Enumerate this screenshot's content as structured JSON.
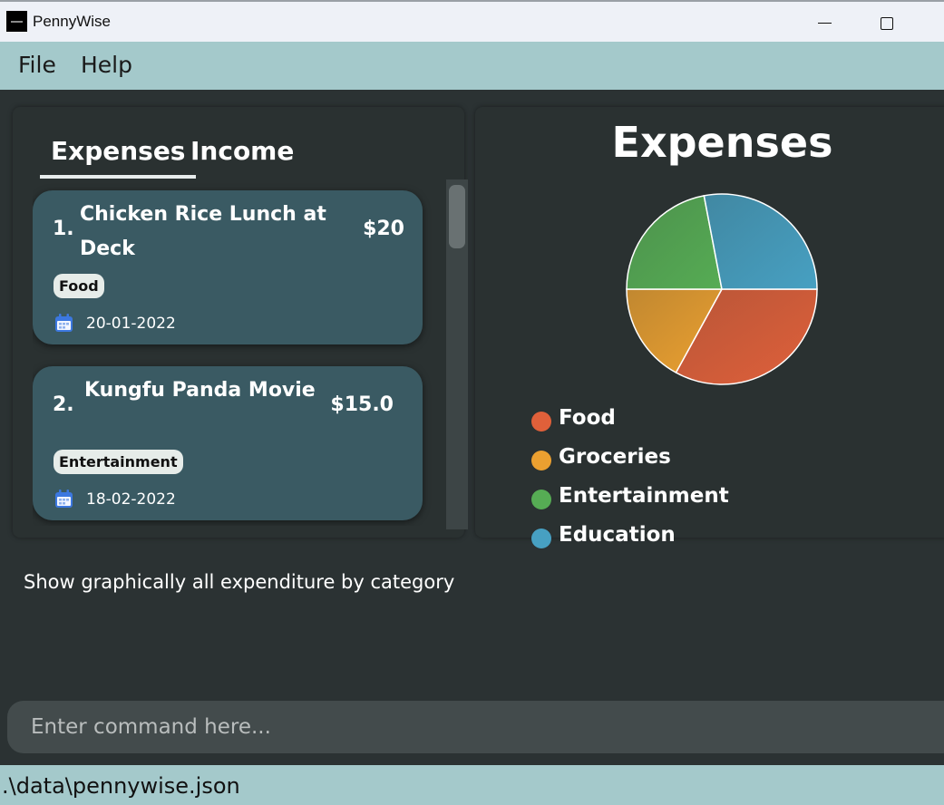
{
  "window": {
    "title": "PennyWise"
  },
  "menu": {
    "file_label": "File",
    "help_label": "Help"
  },
  "tabs": {
    "expenses_label": "Expenses",
    "income_label": "Income",
    "active": "Expenses"
  },
  "expenses": [
    {
      "index": "1.",
      "description": "Chicken Rice Lunch at Deck",
      "amount": "$20",
      "tag": "Food",
      "date": "20-01-2022"
    },
    {
      "index": "2.",
      "description": "Kungfu Panda Movie",
      "amount": "$15.0",
      "tag": "Entertainment",
      "date": "18-02-2022"
    }
  ],
  "chart_data": {
    "type": "pie",
    "title": "Expenses",
    "categories": [
      "Food",
      "Groceries",
      "Entertainment",
      "Education"
    ],
    "values": [
      33,
      17,
      22,
      28
    ],
    "colors": [
      "#e0603a",
      "#eba030",
      "#56ac54",
      "#47a0c2"
    ],
    "legend_position": "bottom-left"
  },
  "result": {
    "message": "Show graphically all expenditure by category"
  },
  "command": {
    "placeholder": "Enter command here...",
    "value": ""
  },
  "status": {
    "file_path": ".\\data\\pennywise.json"
  },
  "icons": {
    "date": "calendar-icon",
    "minimize": "minimize-icon",
    "maximize": "maximize-icon",
    "logo": "app-logo-icon"
  }
}
